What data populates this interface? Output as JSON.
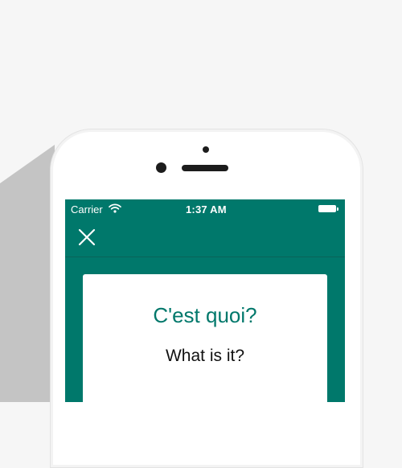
{
  "colors": {
    "accent": "#00786b",
    "background": "#f6f6f6",
    "phone_body": "#ffffff",
    "shadow": "#c4c4c4"
  },
  "status_bar": {
    "carrier": "Carrier",
    "time": "1:37 AM",
    "wifi_icon": "wifi-icon",
    "battery_icon": "battery-icon"
  },
  "nav_bar": {
    "close_icon": "close-icon"
  },
  "card": {
    "question": "C'est quoi?",
    "translation": "What is it?"
  }
}
